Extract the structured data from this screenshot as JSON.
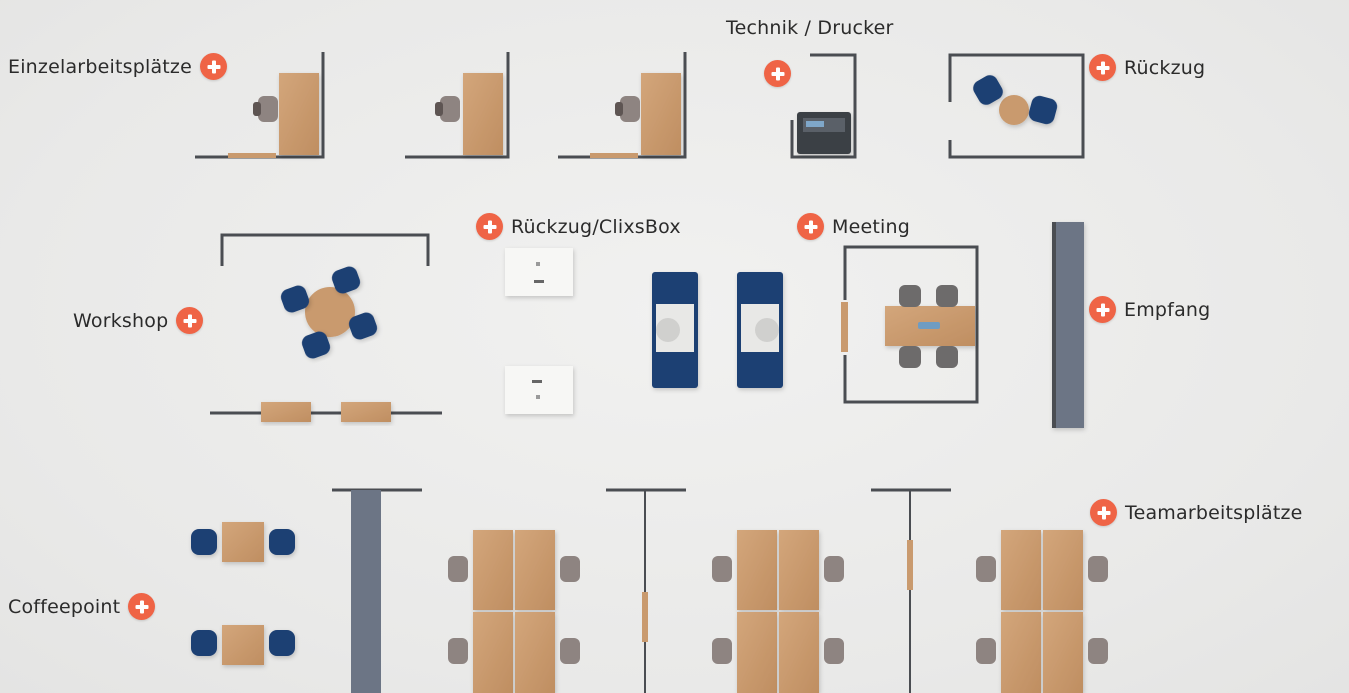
{
  "hotspots": {
    "einzelarbeitsplaetze": "Einzelarbeitsplätze",
    "technik_drucker": "Technik / Drucker",
    "rueckzug": "Rückzug",
    "rueckzug_clixsbox": "Rückzug/ClixsBox",
    "meeting": "Meeting",
    "workshop": "Workshop",
    "empfang": "Empfang",
    "teamarbeitsplaetze": "Teamarbeitsplätze",
    "coffeepoint": "Coffeepoint"
  },
  "icons": {
    "hotspot": "plus-icon"
  },
  "colors": {
    "accent": "#ef6446",
    "wood": "#c99a6e",
    "chair_blue": "#1f3f73",
    "wall": "#4a4d52",
    "reception": "#6c7585"
  }
}
